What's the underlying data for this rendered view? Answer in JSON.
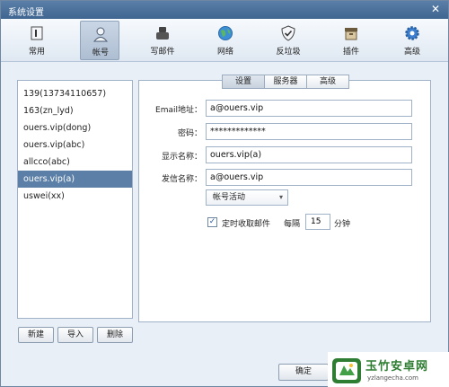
{
  "window": {
    "title": "系统设置",
    "close_glyph": "✕"
  },
  "toolbar": {
    "items": [
      {
        "label": "常用",
        "icon": "general-icon"
      },
      {
        "label": "帐号",
        "icon": "account-icon"
      },
      {
        "label": "写邮件",
        "icon": "compose-icon"
      },
      {
        "label": "网络",
        "icon": "network-icon"
      },
      {
        "label": "反垃圾",
        "icon": "antispam-shield-icon"
      },
      {
        "label": "插件",
        "icon": "plugin-box-icon"
      },
      {
        "label": "高级",
        "icon": "advanced-gear-icon"
      }
    ],
    "active_index": 1
  },
  "accounts": {
    "items": [
      "139(13734110657)",
      "163(zn_lyd)",
      "ouers.vip(dong)",
      "ouers.vip(abc)",
      "allcco(abc)",
      "ouers.vip(a)",
      "uswei(xx)"
    ],
    "selected_index": 5,
    "buttons": {
      "new": "新建",
      "import": "导入",
      "delete": "删除"
    }
  },
  "tabs": {
    "items": [
      "设置",
      "服务器",
      "高级"
    ],
    "active_index": 0
  },
  "form": {
    "email_label": "Email地址：",
    "email_value": "a@ouers.vip",
    "password_label": "密码：",
    "password_value": "*************",
    "display_name_label": "显示名称：",
    "display_name_value": "ouers.vip(a)",
    "sender_name_label": "发信名称：",
    "sender_name_value": "a@ouers.vip",
    "account_status": "帐号活动",
    "auto_fetch_label": "定时收取邮件",
    "auto_fetch_checked": true,
    "interval_prefix": "每隔",
    "interval_value": "15",
    "interval_unit": "分钟"
  },
  "footer": {
    "ok_label": "确定"
  },
  "watermark": {
    "title": "玉竹安卓网",
    "url": "yzlangecha.com"
  },
  "colors": {
    "accent": "#5b7fa6",
    "titlebar": "#4a719b",
    "watermark_green": "#2e7d32"
  }
}
